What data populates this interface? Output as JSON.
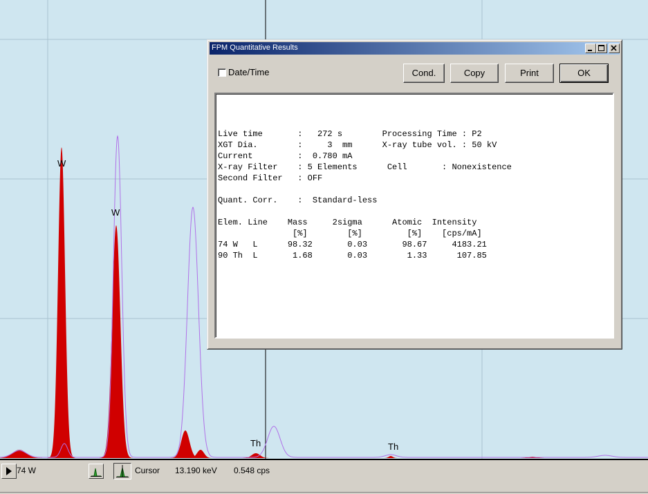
{
  "spectrum": {
    "peak_labels": [
      {
        "element": "W"
      },
      {
        "element": "W"
      },
      {
        "element": "Th"
      },
      {
        "element": "Th"
      }
    ],
    "colors": {
      "background": "#cfe6f0",
      "measured": "#d00000",
      "fit_line": "#b070e8",
      "grid": "#a9c3d0"
    }
  },
  "status_bar": {
    "element": "74 W",
    "cursor_label": "Cursor",
    "energy": "13.190 keV",
    "count_rate": "0.548 cps",
    "icons": [
      "play-arrow-icon",
      "spectrum-peak-icon",
      "cursor-spectrum-icon"
    ]
  },
  "dialog": {
    "title": "FPM Quantitative Results",
    "checkbox": {
      "label": "Date/Time",
      "checked": false
    },
    "buttons": {
      "cond": "Cond.",
      "copy": "Copy",
      "print": "Print",
      "ok": "OK"
    },
    "window_controls": [
      "minimize-icon",
      "maximize-icon",
      "close-icon"
    ],
    "results_lines": [
      "Live time       :   272 s        Processing Time : P2",
      "XGT Dia.        :     3  mm      X-ray tube vol. : 50 kV",
      "Current         :  0.780 mA",
      "X-ray Filter    : 5 Elements      Cell       : Nonexistence",
      "Second Filter   : OFF",
      "",
      "Quant. Corr.    :  Standard-less",
      "",
      "Elem. Line    Mass     2sigma      Atomic  Intensity",
      "               [%]        [%]         [%]    [cps/mA]",
      "74 W   L      98.32       0.03       98.67     4183.21",
      "90 Th  L       1.68       0.03        1.33      107.85"
    ]
  }
}
